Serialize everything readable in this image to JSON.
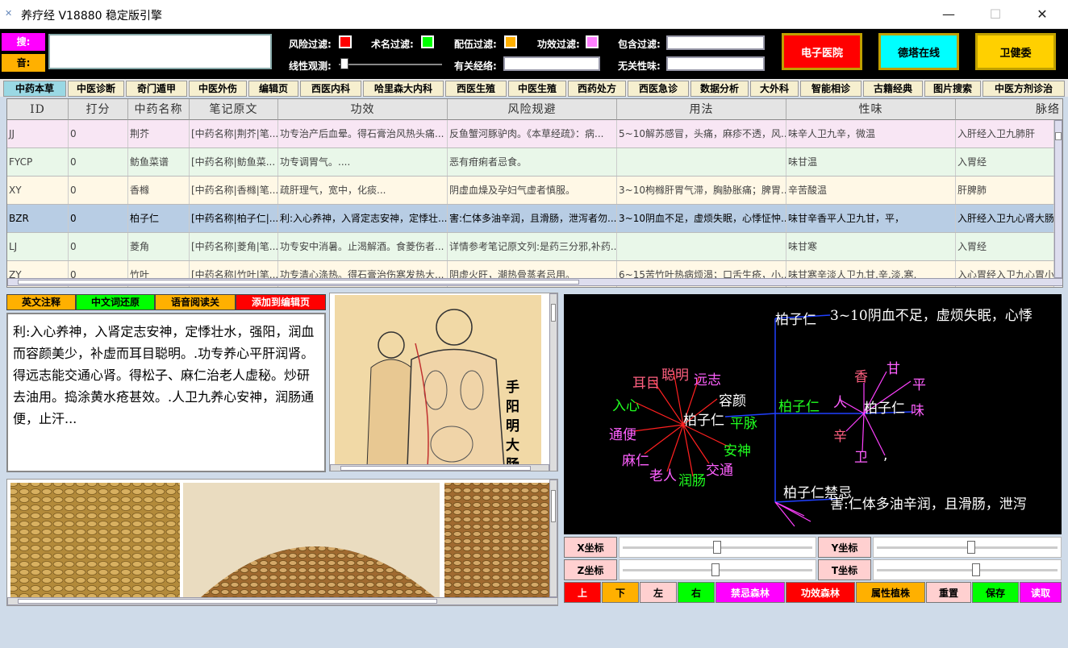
{
  "window": {
    "title": "养疗经 V18880 稳定版引擎",
    "minimize": "—",
    "maximize": "☐",
    "close": "✕"
  },
  "toolbar": {
    "search_label": "搜:",
    "audio_label": "音:",
    "risk_filter": "风险过滤:",
    "surgery_filter": "术名过滤:",
    "combo_filter": "配伍过滤:",
    "effect_filter": "功效过滤:",
    "include_filter": "包含过滤:",
    "linear_view": "线性观测:",
    "related_meridian": "有关经络:",
    "unrelated_nature": "无关性味:",
    "btn_ehospital": "电子医院",
    "btn_detha": "德塔在线",
    "btn_health": "卫健委"
  },
  "tabs": [
    "中药本草",
    "中医诊断",
    "奇门遁甲",
    "中医外伤",
    "编辑页",
    "西医内科",
    "哈里森大内科",
    "西医生殖",
    "中医生殖",
    "西药处方",
    "西医急诊",
    "数据分析",
    "大外科",
    "智能相诊",
    "古籍经典",
    "图片搜索",
    "中医方剂诊治"
  ],
  "table": {
    "headers": [
      "ID",
      "打分",
      "中药名称",
      "笔记原文",
      "功效",
      "风险规避",
      "用法",
      "性味",
      "脉络"
    ],
    "rows": [
      [
        "JJ",
        "0",
        "荆芥",
        "[中药名称|荆芥|笔...",
        "功专治产后血晕。得石膏治风热头痛...",
        "反鱼蟹河豚驴肉。《本草经疏》：病...",
        "5~10解苏感冒，头痛，麻疹不透，风...",
        "味辛人卫九辛，微温",
        "入肝经入卫九肺肝"
      ],
      [
        "FYCP",
        "0",
        "鲂鱼菜谱",
        "[中药名称|鲂鱼菜...",
        "功专调胃气。....",
        "恶有疳痢者忌食。",
        "",
        "味甘温",
        "入胃经"
      ],
      [
        "XY",
        "0",
        "香橼",
        "[中药名称|香橼|笔...",
        "疏肝理气，宽中，化痰...",
        "阴虚血燥及孕妇气虚者慎服。",
        "3~10枸橼肝胃气滞，胸胁胀痛；脾胃...",
        "辛苦酸温",
        "肝脾肺"
      ],
      [
        "BZR",
        "0",
        "柏子仁",
        "[中药名称|柏子仁|...",
        "利:入心养神，入肾定志安神，定悸壮...",
        "害:仁体多油辛润，且滑肠，泄泻者勿...",
        "3~10阴血不足，虚烦失眠，心悸怔忡...",
        "味甘辛香平人卫九甘，平，",
        "入肝经入卫九心肾大肠"
      ],
      [
        "LJ",
        "0",
        "菱角",
        "[中药名称|菱角|笔...",
        "功专安中消暑。止渴解酒。食菱伤者...",
        "详情参考笔记原文列:是药三分邪,补药...",
        "",
        "味甘寒",
        "入胃经"
      ],
      [
        "ZY",
        "0",
        "竹叶",
        "[中药名称|竹叶|笔...",
        "功专清心涤热。得石膏治伤寒发热大...",
        "阴虚火旺，潮热骨蒸者忌用。",
        "6~15苦竹叶热病烦渴；口舌生疮，小...",
        "味甘寒辛淡人卫九甘,辛,淡,寒,",
        "入心胃经入卫九心胃小"
      ]
    ]
  },
  "actions": {
    "english": "英文注释",
    "chinese": "中文词还原",
    "voice": "语音阅读关",
    "add": "添加到编辑页"
  },
  "note_text": "利:入心养神，入肾定志安神，定悸壮水，强阳，润血而容颜美少，补虚而耳目聪明。.功专养心平肝润肾。得远志能交通心肾。得松子、麻仁治老人虚秘。炒研去油用。捣涂黄水疮甚效。.人卫九养心安神，润肠通便，止汗...",
  "diagram_text": "手阳明大肠",
  "graph": {
    "top_label": "柏子仁",
    "top_text": "3~10阴血不足，虚烦失眠，心悸",
    "center": "柏子仁",
    "center2": "平脉",
    "mid_node": "柏子仁",
    "right_center": "柏子仁",
    "right_suffix": "味",
    "bottom_label": "柏子仁禁忌",
    "bottom_text": "害:仁体多油辛润，且滑肠，泄泻",
    "left_nodes": [
      "耳目",
      "聪明",
      "远志",
      "容颜",
      "入心",
      "通便",
      "麻仁",
      "老人",
      "润肠",
      "交通",
      "安神"
    ],
    "right_nodes": [
      "香",
      "甘",
      "平",
      "人",
      "辛",
      "卫",
      ","
    ]
  },
  "coords": {
    "x": "X坐标",
    "y": "Y坐标",
    "z": "Z坐标",
    "t": "T坐标"
  },
  "controls": [
    "上",
    "下",
    "左",
    "右",
    "禁忌森林",
    "功效森林",
    "属性植株",
    "重置",
    "保存",
    "读取"
  ],
  "colors": {
    "magenta": "#ff00ff",
    "orange": "#ffb000",
    "green": "#00ff00",
    "red": "#ff0000",
    "cyan": "#00ffff",
    "pink": "#ffd0d0"
  }
}
